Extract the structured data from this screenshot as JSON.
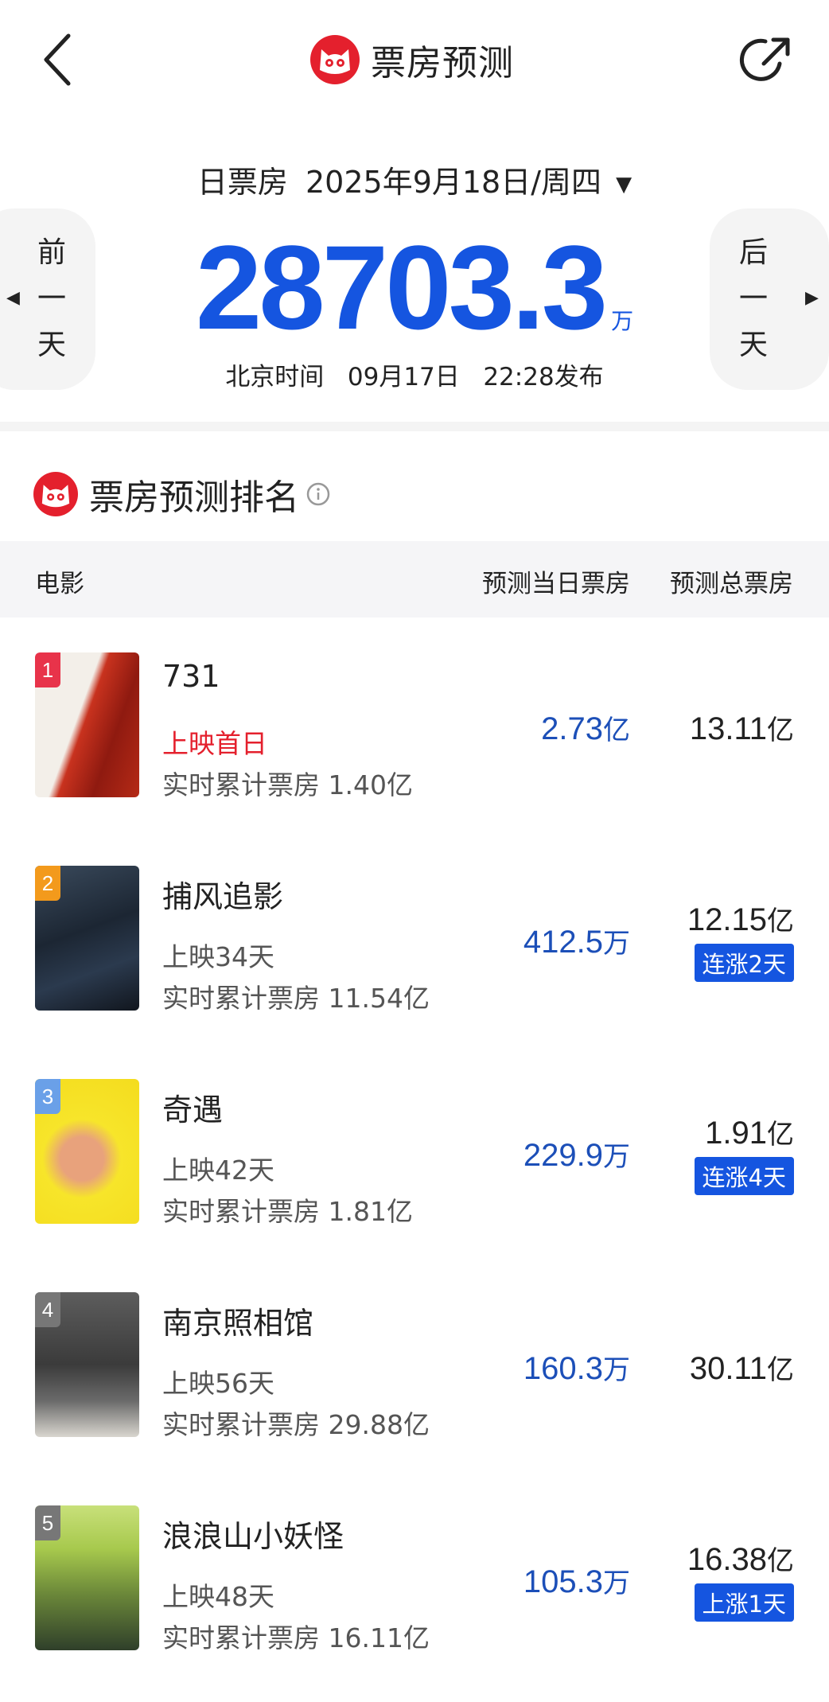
{
  "header": {
    "title": "票房预测"
  },
  "summary": {
    "label": "日票房",
    "date": "2025年9月18日/周四",
    "value": "28703.3",
    "unit": "万",
    "publish": "北京时间   09月17日   22:28发布",
    "prev_label": [
      "前",
      "一",
      "天"
    ],
    "next_label": [
      "后",
      "一",
      "天"
    ]
  },
  "ranking": {
    "title": "票房预测排名",
    "columns": {
      "movie": "电影",
      "today": "预测当日票房",
      "total": "预测总票房"
    },
    "rows": [
      {
        "rank": "1",
        "name": "731",
        "status": "上映首日",
        "cumulative": "实时累计票房 1.40亿",
        "today": "2.73",
        "today_unit": "亿",
        "total": "13.11",
        "total_unit": "亿",
        "badge": "",
        "rank_color": "#e8334a"
      },
      {
        "rank": "2",
        "name": "捕风追影",
        "status": "上映34天",
        "cumulative": "实时累计票房 11.54亿",
        "today": "412.5",
        "today_unit": "万",
        "total": "12.15",
        "total_unit": "亿",
        "badge": "连涨2天",
        "rank_color": "#f39a1c"
      },
      {
        "rank": "3",
        "name": "奇遇",
        "status": "上映42天",
        "cumulative": "实时累计票房 1.81亿",
        "today": "229.9",
        "today_unit": "万",
        "total": "1.91",
        "total_unit": "亿",
        "badge": "连涨4天",
        "rank_color": "#6aa0e8"
      },
      {
        "rank": "4",
        "name": "南京照相馆",
        "status": "上映56天",
        "cumulative": "实时累计票房 29.88亿",
        "today": "160.3",
        "today_unit": "万",
        "total": "30.11",
        "total_unit": "亿",
        "badge": "",
        "rank_color": "#777777"
      },
      {
        "rank": "5",
        "name": "浪浪山小妖怪",
        "status": "上映48天",
        "cumulative": "实时累计票房 16.11亿",
        "today": "105.3",
        "today_unit": "万",
        "total": "16.38",
        "total_unit": "亿",
        "badge": "上涨1天",
        "rank_color": "#777777"
      }
    ]
  },
  "colors": {
    "accent": "#1555e0",
    "brand": "#e4202d"
  }
}
